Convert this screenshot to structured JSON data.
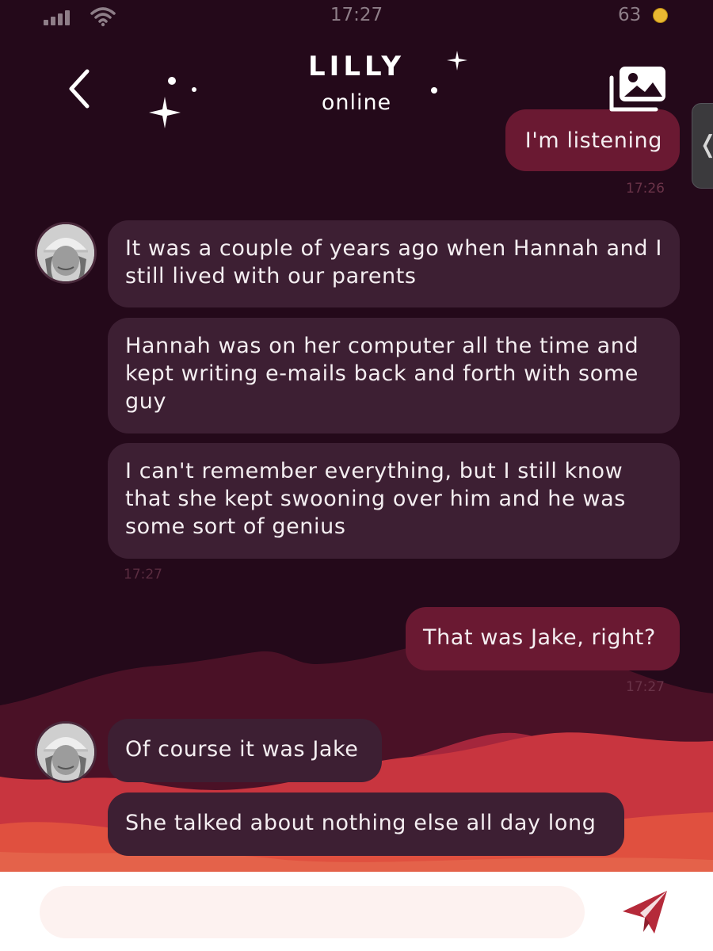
{
  "status_bar": {
    "time": "17:27",
    "coins": "63"
  },
  "header": {
    "name": "LILLY",
    "status": "online"
  },
  "messages": [
    {
      "dir": "out",
      "text": "I'm listening",
      "time": "17:26"
    },
    {
      "dir": "in",
      "text": "It was a couple of years ago when Hannah and I still lived with our parents"
    },
    {
      "dir": "in",
      "text": "Hannah was on her computer all the time and kept writing e-mails back and forth with some guy"
    },
    {
      "dir": "in",
      "text": "I can't remember everything, but I still know that she kept swooning over him and he was some sort of genius",
      "time": "17:27"
    },
    {
      "dir": "out",
      "text": "That was Jake, right?",
      "time": "17:27"
    },
    {
      "dir": "in",
      "text": "Of course it was Jake"
    },
    {
      "dir": "in",
      "text": "She talked about nothing else all day long"
    }
  ],
  "composer": {
    "placeholder": ""
  },
  "colors": {
    "background": "#24091a",
    "incoming_bubble": "#3d1f33",
    "outgoing_bubble": "#6a1932",
    "accent": "#b52a3a",
    "coin": "#e9b832"
  },
  "icons": {
    "back": "chevron-left-icon",
    "gallery": "image-gallery-icon",
    "send": "paper-plane-icon",
    "coin": "coin-icon",
    "handle": "chevron-left-icon"
  }
}
